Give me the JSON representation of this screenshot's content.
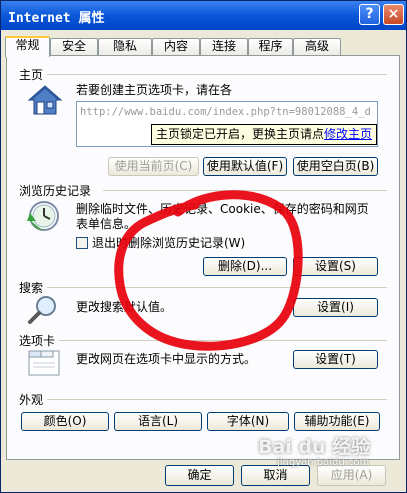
{
  "window": {
    "title": "Internet 属性",
    "help_label": "?",
    "close_label": "×"
  },
  "tabs": [
    {
      "label": "常规"
    },
    {
      "label": "安全"
    },
    {
      "label": "隐私"
    },
    {
      "label": "内容"
    },
    {
      "label": "连接"
    },
    {
      "label": "程序"
    },
    {
      "label": "高级"
    }
  ],
  "homepage": {
    "group_label": "主页",
    "description": "若要创建主页选项卡，请在各",
    "url": "http://www.baidu.com/index.php?tn=98012088_4_d",
    "tooltip_text": "主页锁定已开启，更换主页请点",
    "tooltip_link": "修改主页",
    "use_current": "使用当前页(C)",
    "use_default": "使用默认值(F)",
    "use_blank": "使用空白页(B)"
  },
  "history": {
    "group_label": "浏览历史记录",
    "description_line1": "删除临时文件、历史记录、Cookie、保存的密码和网页",
    "description_line2": "表单信息。",
    "checkbox_label": "退出时删除浏览历史记录(W)",
    "delete_button": "删除(D)...",
    "settings_button": "设置(S)"
  },
  "search": {
    "group_label": "搜索",
    "description": "更改搜索默认值。",
    "settings_button": "设置(I)"
  },
  "tabs_section": {
    "group_label": "选项卡",
    "description": "更改网页在选项卡中显示的方式。",
    "settings_button": "设置(T)"
  },
  "appearance": {
    "group_label": "外观",
    "colors_button": "颜色(O)",
    "languages_button": "语言(L)",
    "fonts_button": "字体(N)",
    "accessibility_button": "辅助功能(E)"
  },
  "footer": {
    "ok": "确定",
    "cancel": "取消",
    "apply": "应用(A)"
  },
  "watermark": {
    "brand": "Bai du 经验",
    "url": "jingyan.baidu.com"
  },
  "colors": {
    "title_bar": "#0a57d8",
    "annotation": "#e8000b",
    "tooltip_bg": "#ffffe1"
  }
}
